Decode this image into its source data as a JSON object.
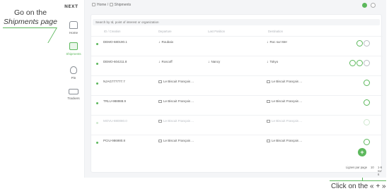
{
  "annotations": {
    "top_line1": "Go on the",
    "top_line2": "Shipments page",
    "bottom": "Click on the « + »"
  },
  "app": {
    "logo": "NEXT",
    "sidebar": [
      {
        "label": "Home",
        "icon": "house-icon"
      },
      {
        "label": "Shipments",
        "icon": "box-icon",
        "active": true
      },
      {
        "label": "Pin",
        "icon": "pin-icon"
      },
      {
        "label": "Trackers",
        "icon": "truck-icon"
      }
    ],
    "breadcrumb": {
      "home": "Home",
      "separator": "/",
      "current": "Shipments"
    },
    "search_placeholder": "Search by Id, point of interest or organization",
    "columns": [
      "ID / Creation",
      "Departure",
      "Last Position",
      "Destination"
    ],
    "rows": [
      {
        "title": "DEMO-680190.1",
        "departure": "Roubaix",
        "position": "",
        "destination": "Roc sur Mer",
        "greyed": false
      },
      {
        "title": "DEMO-604211.8",
        "departure": "Roscoff",
        "position": "Nancy",
        "destination": "Tokyo",
        "greyed": false
      },
      {
        "title": "NJAG777777.7",
        "departure": "Le Biscuit Français ...",
        "position": "",
        "destination": "Le Biscuit Français ...",
        "greyed": false
      },
      {
        "title": "TRLU-988988.9",
        "departure": "Le Biscuit Français ...",
        "position": "",
        "destination": "Le Biscuit Français ...",
        "greyed": false
      },
      {
        "title": "MOVU-880080.0",
        "departure": "Le Biscuit Français ...",
        "position": "",
        "destination": "Le Biscuit Français ...",
        "greyed": true
      },
      {
        "title": "PCIU-986980.8",
        "departure": "Le Biscuit Français ...",
        "position": "",
        "destination": "Le Biscuit Français ...",
        "greyed": false
      }
    ],
    "footer": {
      "rows_label": "Lignes par page",
      "per_page": "10",
      "range": "1-6 sur 6"
    },
    "fab_label": "+"
  },
  "colors": {
    "accent": "#5cb85c"
  }
}
